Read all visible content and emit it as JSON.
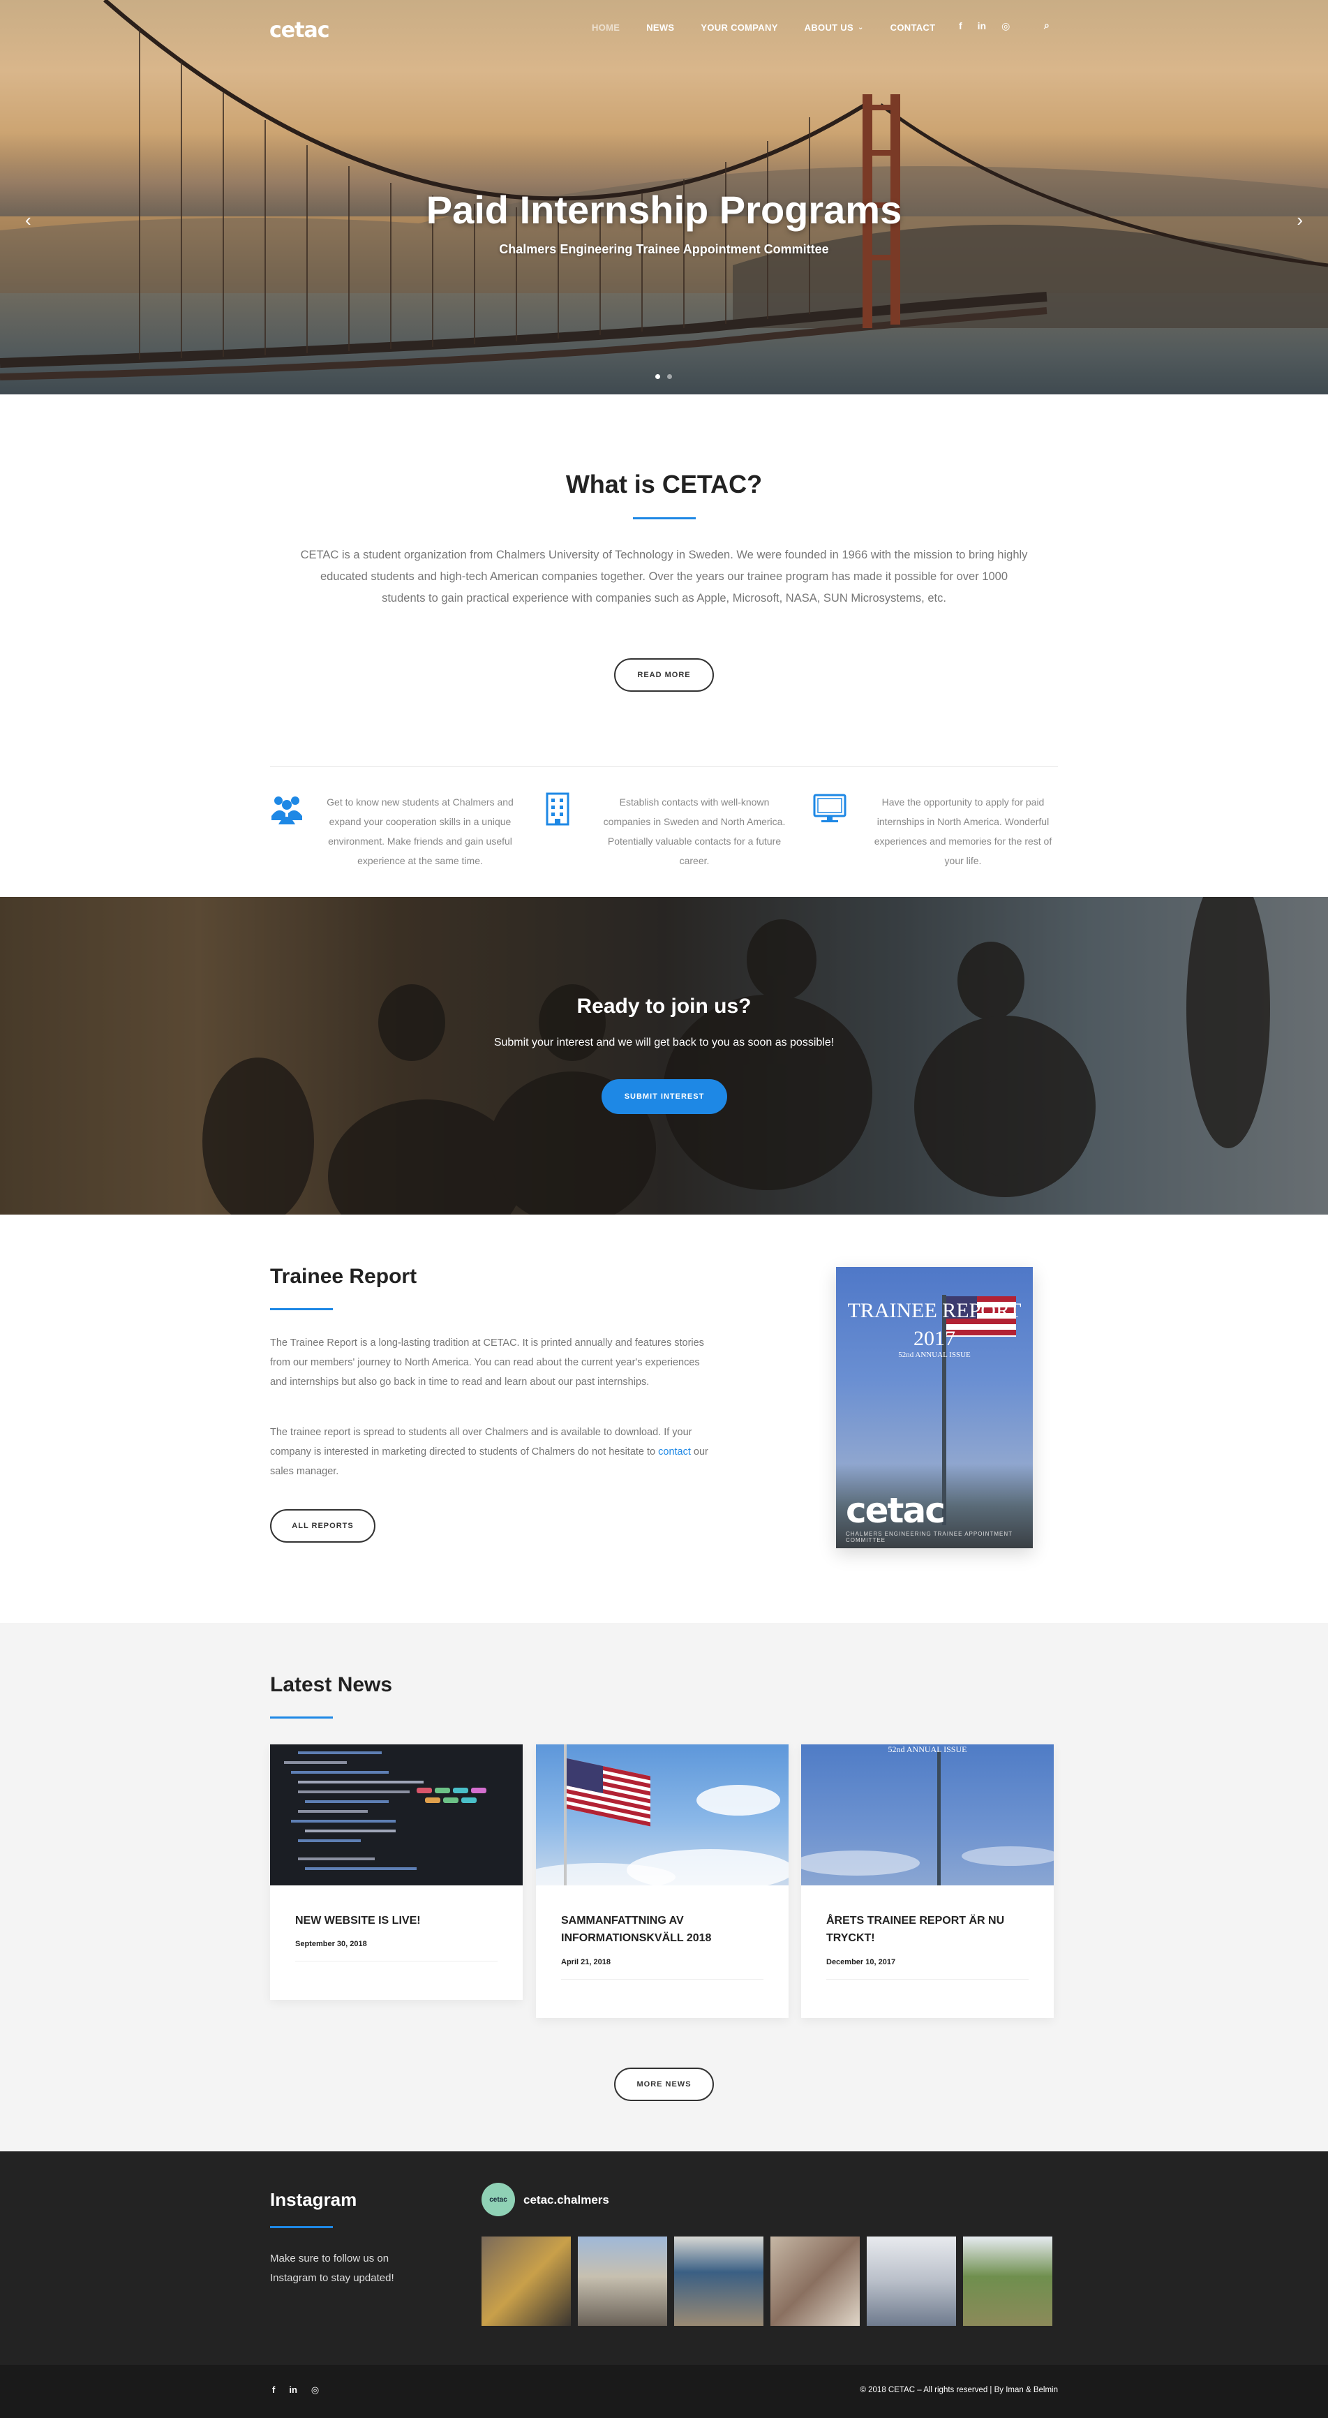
{
  "nav": {
    "logo": "cetac",
    "items": [
      "HOME",
      "NEWS",
      "YOUR COMPANY",
      "ABOUT US",
      "CONTACT"
    ],
    "social": [
      "f",
      "in",
      "ig"
    ]
  },
  "hero": {
    "title": "Paid Internship Programs",
    "subtitle": "Chalmers Engineering Trainee Appointment Committee",
    "prev": "‹",
    "next": "›"
  },
  "about": {
    "title": "What is CETAC?",
    "text": "CETAC is a student organization from Chalmers University of Technology in Sweden. We were founded in 1966 with the mission to bring highly educated students and high-tech American companies together. Over the years our trainee program has made it possible for over 1000 students to gain practical experience with companies such as Apple, Microsoft, NASA, SUN Microsystems, etc.",
    "button": "READ MORE",
    "features": [
      "Get to know new students at Chalmers and expand your cooperation skills in a unique environment. Make friends and gain useful experience at the same time.",
      "Establish contacts with well-known companies in Sweden and North America. Potentially valuable contacts for a future career.",
      "Have the opportunity to apply for paid internships in North America. Wonderful experiences and memories for the rest of your life."
    ]
  },
  "join": {
    "title": "Ready to join us?",
    "text": "Submit your interest and we will get back to you as soon as possible!",
    "button": "SUBMIT INTEREST"
  },
  "report": {
    "title": "Trainee Report",
    "p1": "The Trainee Report is a long-lasting tradition at CETAC. It is printed annually and features stories from our members' journey to North America. You can read about the current year's experiences and internships but also go back in time to read and learn about our past internships.",
    "p2_a": "The trainee report is spread to students all over Chalmers and is available to download. If your company is interested in marketing directed to students of Chalmers do not hesitate to ",
    "p2_link": "contact",
    "p2_b": " our sales manager.",
    "button": "ALL REPORTS",
    "cover": {
      "title": "TRAINEE REPORT",
      "year": "2017",
      "issue": "52nd ANNUAL ISSUE",
      "logo": "cetac",
      "sub": "CHALMERS ENGINEERING TRAINEE APPOINTMENT COMMITTEE"
    }
  },
  "news": {
    "title": "Latest News",
    "items": [
      {
        "title": "NEW WEBSITE IS LIVE!",
        "date": "September 30, 2018"
      },
      {
        "title": "SAMMANFATTNING AV INFORMATIONSKVÄLL 2018",
        "date": "April 21, 2018"
      },
      {
        "title": "ÅRETS TRAINEE REPORT ÄR NU TRYCKT!",
        "date": "December 10, 2017"
      }
    ],
    "card3_caption": "52nd ANNUAL ISSUE",
    "button": "MORE NEWS"
  },
  "instagram": {
    "title": "Instagram",
    "text": "Make sure to follow us on Instagram to stay updated!",
    "handle": "cetac.chalmers",
    "avatar": "cetac"
  },
  "footer": {
    "social": [
      "f",
      "in",
      "ig"
    ],
    "copyright": "© 2018 CETAC – All rights reserved   |   By Iman & Belmin"
  }
}
